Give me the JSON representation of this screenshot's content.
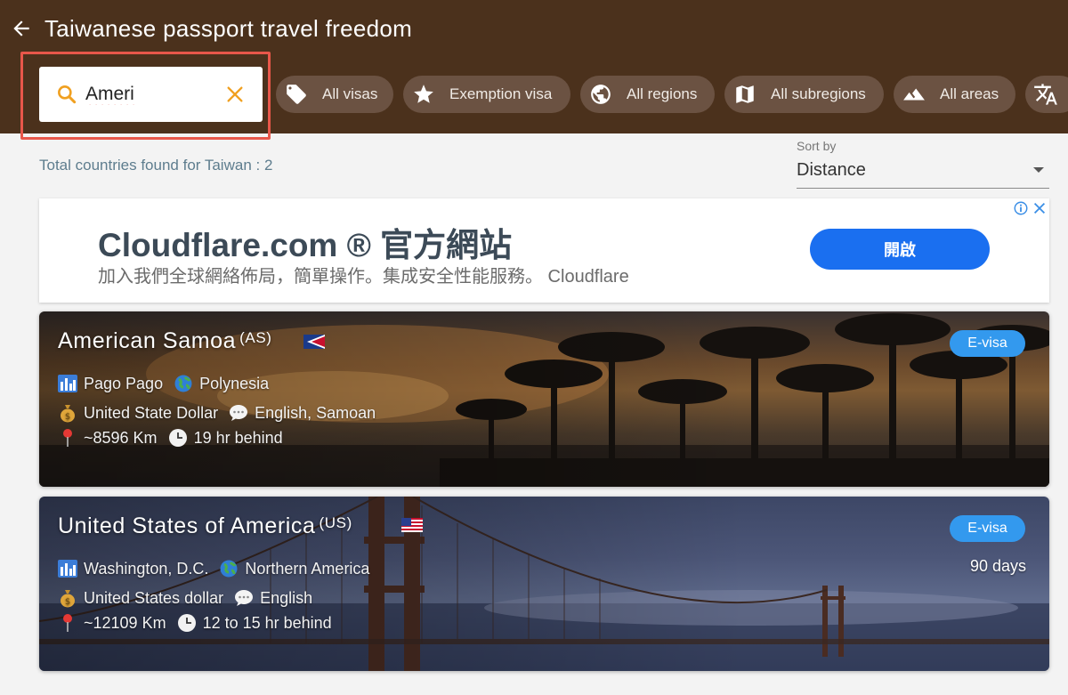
{
  "header": {
    "title": "Taiwanese passport travel freedom"
  },
  "search": {
    "value": "Ameri"
  },
  "filters": [
    {
      "label": "All visas",
      "icon": "tag-icon"
    },
    {
      "label": "Exemption visa",
      "icon": "star-icon"
    },
    {
      "label": "All regions",
      "icon": "globe-icon"
    },
    {
      "label": "All subregions",
      "icon": "map-icon"
    },
    {
      "label": "All areas",
      "icon": "mountain-icon"
    }
  ],
  "results": {
    "total_text": "Total countries found for Taiwan : 2"
  },
  "sort": {
    "label": "Sort by",
    "value": "Distance"
  },
  "ad": {
    "headline": "Cloudflare.com ® 官方網站",
    "subtext": "加入我們全球網絡佈局，簡單操作。集成安全性能服務。 Cloudflare",
    "cta": "開啟"
  },
  "countries": [
    {
      "name": "American Samoa",
      "code": "(AS)",
      "capital": "Pago Pago",
      "region": "Polynesia",
      "currency": "United State Dollar",
      "languages": "English, Samoan",
      "distance": "~8596 Km",
      "time": "19 hr behind",
      "visa": "E-visa",
      "stay": ""
    },
    {
      "name": "United States of America",
      "code": "(US)",
      "capital": "Washington, D.C.",
      "region": "Northern America",
      "currency": "United States dollar",
      "languages": "English",
      "distance": "~12109 Km",
      "time": "12 to 15 hr behind",
      "visa": "E-visa",
      "stay": "90 days"
    }
  ],
  "colors": {
    "appbar": "#4b311c",
    "chip": "#6b5242",
    "badge": "#3399ee",
    "highlight": "#e8574a",
    "search_icon": "#f0a020",
    "ad_cta": "#1a6ff0"
  }
}
